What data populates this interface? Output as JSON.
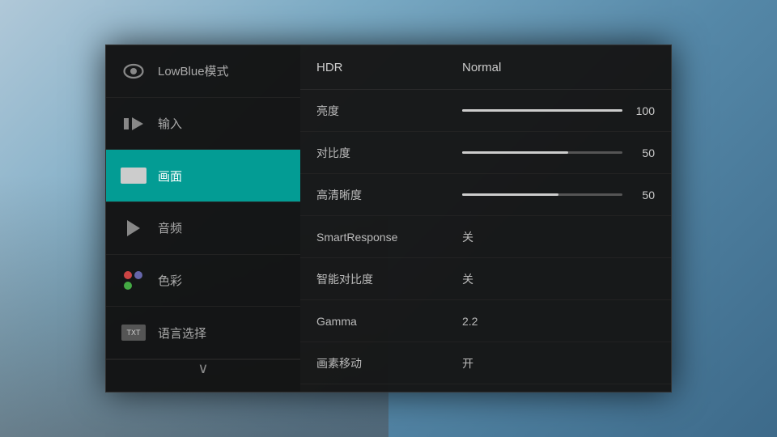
{
  "background": {
    "gradient_desc": "Sky blue gradient with house silhouette"
  },
  "sidebar": {
    "items": [
      {
        "id": "lowblue",
        "label": "LowBlue模式",
        "icon": "eye-icon",
        "active": false
      },
      {
        "id": "input",
        "label": "输入",
        "icon": "input-icon",
        "active": false
      },
      {
        "id": "picture",
        "label": "画面",
        "icon": "picture-icon",
        "active": true
      },
      {
        "id": "audio",
        "label": "音频",
        "icon": "audio-icon",
        "active": false
      },
      {
        "id": "color",
        "label": "色彩",
        "icon": "color-icon",
        "active": false
      },
      {
        "id": "language",
        "label": "语言选择",
        "icon": "lang-icon",
        "active": false
      }
    ],
    "footer": {
      "icon": "chevron-down-icon",
      "symbol": "∨"
    }
  },
  "content": {
    "header": {
      "label": "HDR",
      "value": "Normal"
    },
    "rows": [
      {
        "id": "brightness",
        "label": "亮度",
        "type": "slider",
        "value": 100,
        "fill_percent": 100
      },
      {
        "id": "contrast",
        "label": "对比度",
        "type": "slider",
        "value": 50,
        "fill_percent": 66
      },
      {
        "id": "sharpness",
        "label": "高清晰度",
        "type": "slider",
        "value": 50,
        "fill_percent": 60
      },
      {
        "id": "smartresponse",
        "label": "SmartResponse",
        "type": "text",
        "value": "关"
      },
      {
        "id": "smartcontrast",
        "label": "智能对比度",
        "type": "text",
        "value": "关"
      },
      {
        "id": "gamma",
        "label": "Gamma",
        "type": "text",
        "value": "2.2"
      },
      {
        "id": "pixelshift",
        "label": "画素移动",
        "type": "text",
        "value": "开"
      }
    ]
  }
}
